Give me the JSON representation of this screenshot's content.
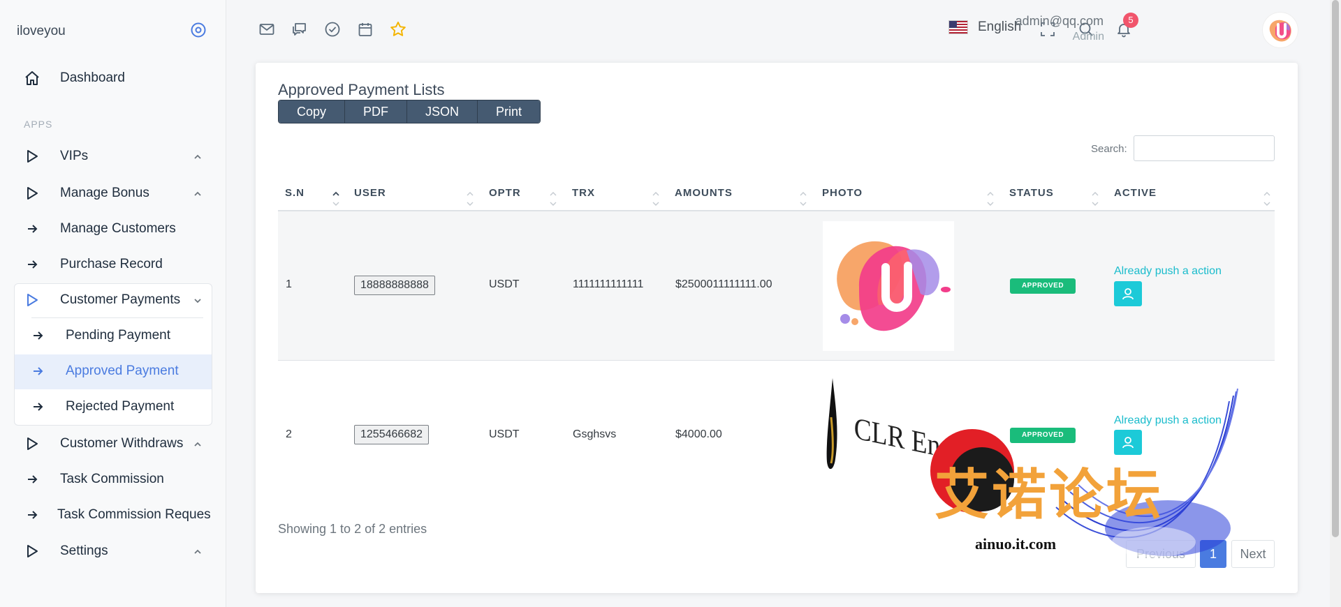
{
  "sidebar": {
    "brand": "iloveyou",
    "section_label": "APPS",
    "items": {
      "dashboard": "Dashboard",
      "vips": "VIPs",
      "manage_bonus": "Manage Bonus",
      "manage_customers": "Manage Customers",
      "purchase_record": "Purchase Record",
      "customer_payments": "Customer Payments",
      "pending_payment": "Pending Payment",
      "approved_payment": "Approved Payment",
      "rejected_payment": "Rejected Payment",
      "customer_withdraws": "Customer Withdraws",
      "task_commission": "Task Commission",
      "task_commission_request": "Task Commission Reques",
      "settings": "Settings"
    }
  },
  "topbar": {
    "language": "English",
    "notification_count": "5",
    "user_email": "admin@qq.com",
    "user_role": "Admin"
  },
  "card": {
    "title": "Approved Payment Lists",
    "export_buttons": [
      "Copy",
      "PDF",
      "JSON",
      "Print"
    ],
    "search_label": "Search:",
    "search_value": "",
    "columns": [
      "S.N",
      "USER",
      "OPTR",
      "TRX",
      "AMOUNTS",
      "PHOTO",
      "STATUS",
      "ACTIVE"
    ],
    "rows": [
      {
        "sn": "1",
        "user": "18888888888",
        "optr": "USDT",
        "trx": "1111111111111",
        "amount": "$2500011111111.00",
        "status": "APPROVED",
        "action": "Already push a action"
      },
      {
        "sn": "2",
        "user": "1255466682",
        "optr": "USDT",
        "trx": "Gsghsvs",
        "amount": "$4000.00",
        "status": "APPROVED",
        "action": "Already push a action"
      }
    ],
    "photo2_text": "CLR Energy",
    "info": "Showing 1 to 2 of 2 entries",
    "pagination": {
      "previous": "Previous",
      "current": "1",
      "next": "Next"
    }
  },
  "watermark": {
    "chinese": "艾诺论坛",
    "domain": "ainuo.it.com"
  },
  "colors": {
    "accent": "#4a7be0",
    "status_green": "#1abc7b",
    "action_cyan": "#1ccad8",
    "button_dark": "#455a71",
    "badge_red": "#f1556c"
  }
}
